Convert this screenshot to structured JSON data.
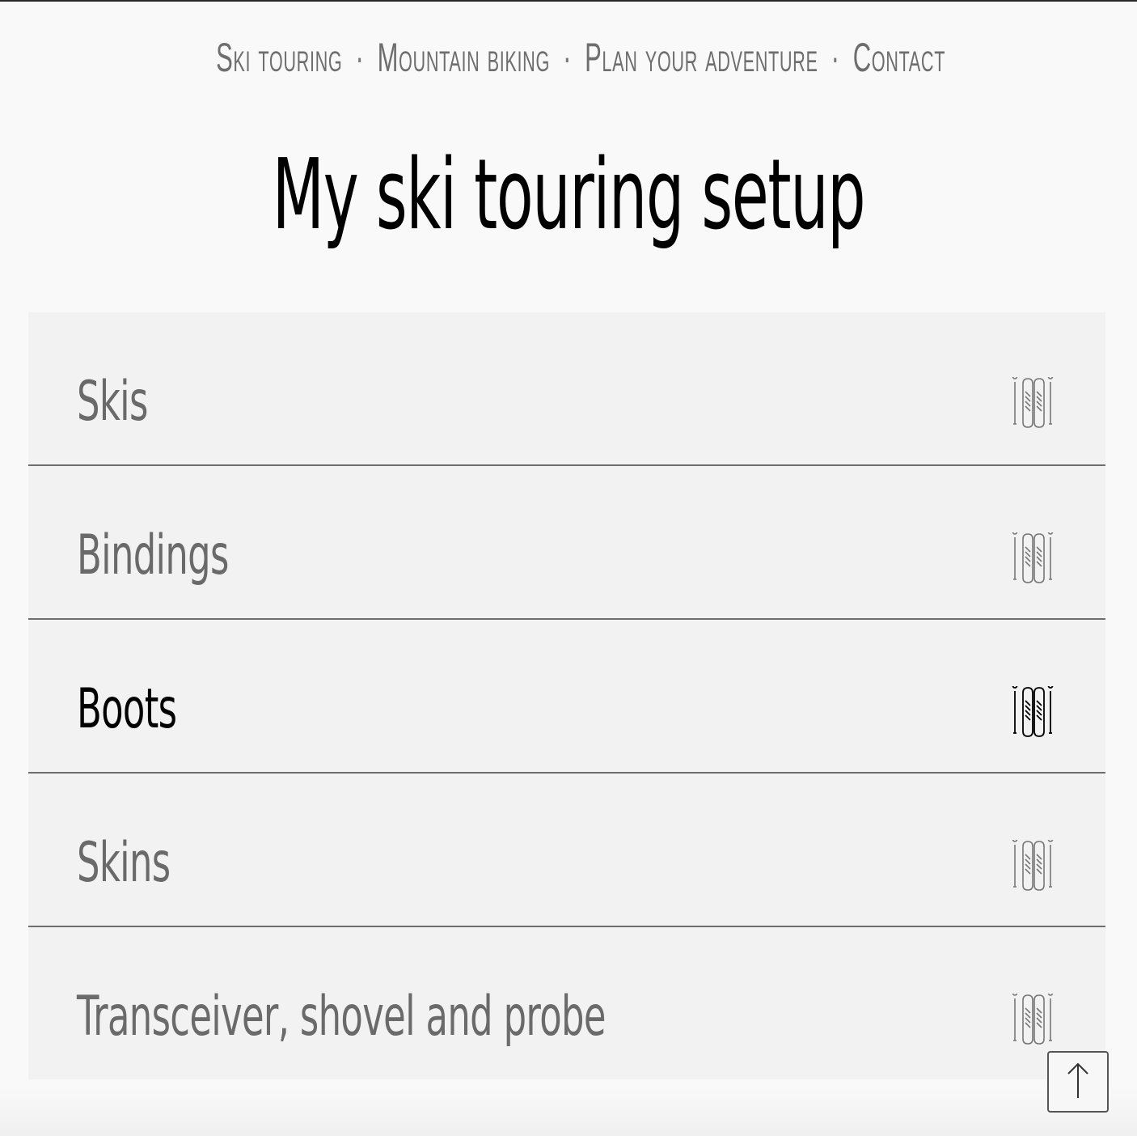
{
  "nav": {
    "items": [
      {
        "label": "Ski touring"
      },
      {
        "label": "Mountain biking"
      },
      {
        "label": "Plan your adventure"
      },
      {
        "label": "Contact"
      }
    ],
    "separator": "·"
  },
  "page": {
    "title": "My ski touring setup"
  },
  "accordion": {
    "items": [
      {
        "label": "Skis",
        "icon": "skis-icon",
        "active": false
      },
      {
        "label": "Bindings",
        "icon": "skis-icon",
        "active": false
      },
      {
        "label": "Boots",
        "icon": "skis-icon",
        "active": true
      },
      {
        "label": "Skins",
        "icon": "skis-icon",
        "active": false
      },
      {
        "label": "Transceiver, shovel and probe",
        "icon": "skis-icon",
        "active": false
      }
    ]
  },
  "back_to_top": {
    "icon": "arrow-up-icon"
  },
  "colors": {
    "background": "#f9f9f9",
    "panel": "#f2f2f2",
    "text_muted": "#6a6a6a",
    "text_active": "#000000",
    "divider": "#6e6e6e"
  }
}
